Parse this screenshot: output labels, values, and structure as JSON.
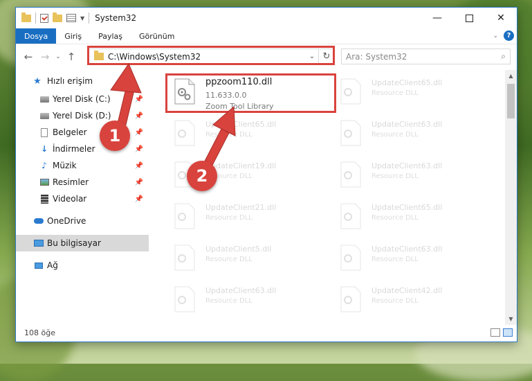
{
  "titlebar": {
    "title": "System32",
    "minimize_icon": "minimize-icon",
    "maximize_icon": "maximize-icon",
    "close_icon": "close-icon"
  },
  "ribbon": {
    "tabs": [
      "Dosya",
      "Giriş",
      "Paylaş",
      "Görünüm"
    ],
    "active_tab": "Dosya",
    "collapse_icon": "chevron-down-icon",
    "help_label": "?"
  },
  "navbar": {
    "back_icon": "back-arrow-icon",
    "forward_icon": "forward-arrow-icon",
    "recent_icon": "chevron-down-icon",
    "up_icon": "up-arrow-icon",
    "address": "C:\\Windows\\System32",
    "search_placeholder": "Ara: System32"
  },
  "sidebar": {
    "quick_access": "Hızlı erişim",
    "items": [
      {
        "label": "Yerel Disk (C:)",
        "icon": "disk-icon"
      },
      {
        "label": "Yerel Disk (D:)",
        "icon": "disk-icon"
      },
      {
        "label": "Belgeler",
        "icon": "document-icon"
      },
      {
        "label": "İndirmeler",
        "icon": "download-icon"
      },
      {
        "label": "Müzik",
        "icon": "music-icon"
      },
      {
        "label": "Resimler",
        "icon": "pictures-icon"
      },
      {
        "label": "Videolar",
        "icon": "video-icon"
      }
    ],
    "onedrive": "OneDrive",
    "this_pc": "Bu bilgisayar",
    "network": "Ağ"
  },
  "files": {
    "featured": {
      "name": "ppzoom110.dll",
      "version": "11.633.0.0",
      "description": "Zoom Tool Library"
    },
    "ghosts": [
      {
        "name": "UpdateClient65.dll",
        "description": "Resource DLL"
      },
      {
        "name": "UpdateClient65.dll",
        "description": "Resource DLL"
      },
      {
        "name": "UpdateClient63.dll",
        "description": "Resource DLL"
      },
      {
        "name": "UpdateClient19.dll",
        "description": "Resource DLL"
      },
      {
        "name": "UpdateClient63.dll",
        "description": "Resource DLL"
      },
      {
        "name": "UpdateClient21.dll",
        "description": "Resource DLL"
      },
      {
        "name": "UpdateClient65.dll",
        "description": "Resource DLL"
      },
      {
        "name": "UpdateClient5.dll",
        "description": "Resource DLL"
      },
      {
        "name": "UpdateClient63.dll",
        "description": "Resource DLL"
      },
      {
        "name": "UpdateClient63.dll",
        "description": "Resource DLL"
      },
      {
        "name": "UpdateClient42.dll",
        "description": "Resource DLL"
      }
    ]
  },
  "status": {
    "item_count": "108 öğe"
  },
  "callouts": {
    "one": "1",
    "two": "2"
  },
  "colors": {
    "accent": "#1a6ec2",
    "highlight": "#d9433d"
  }
}
